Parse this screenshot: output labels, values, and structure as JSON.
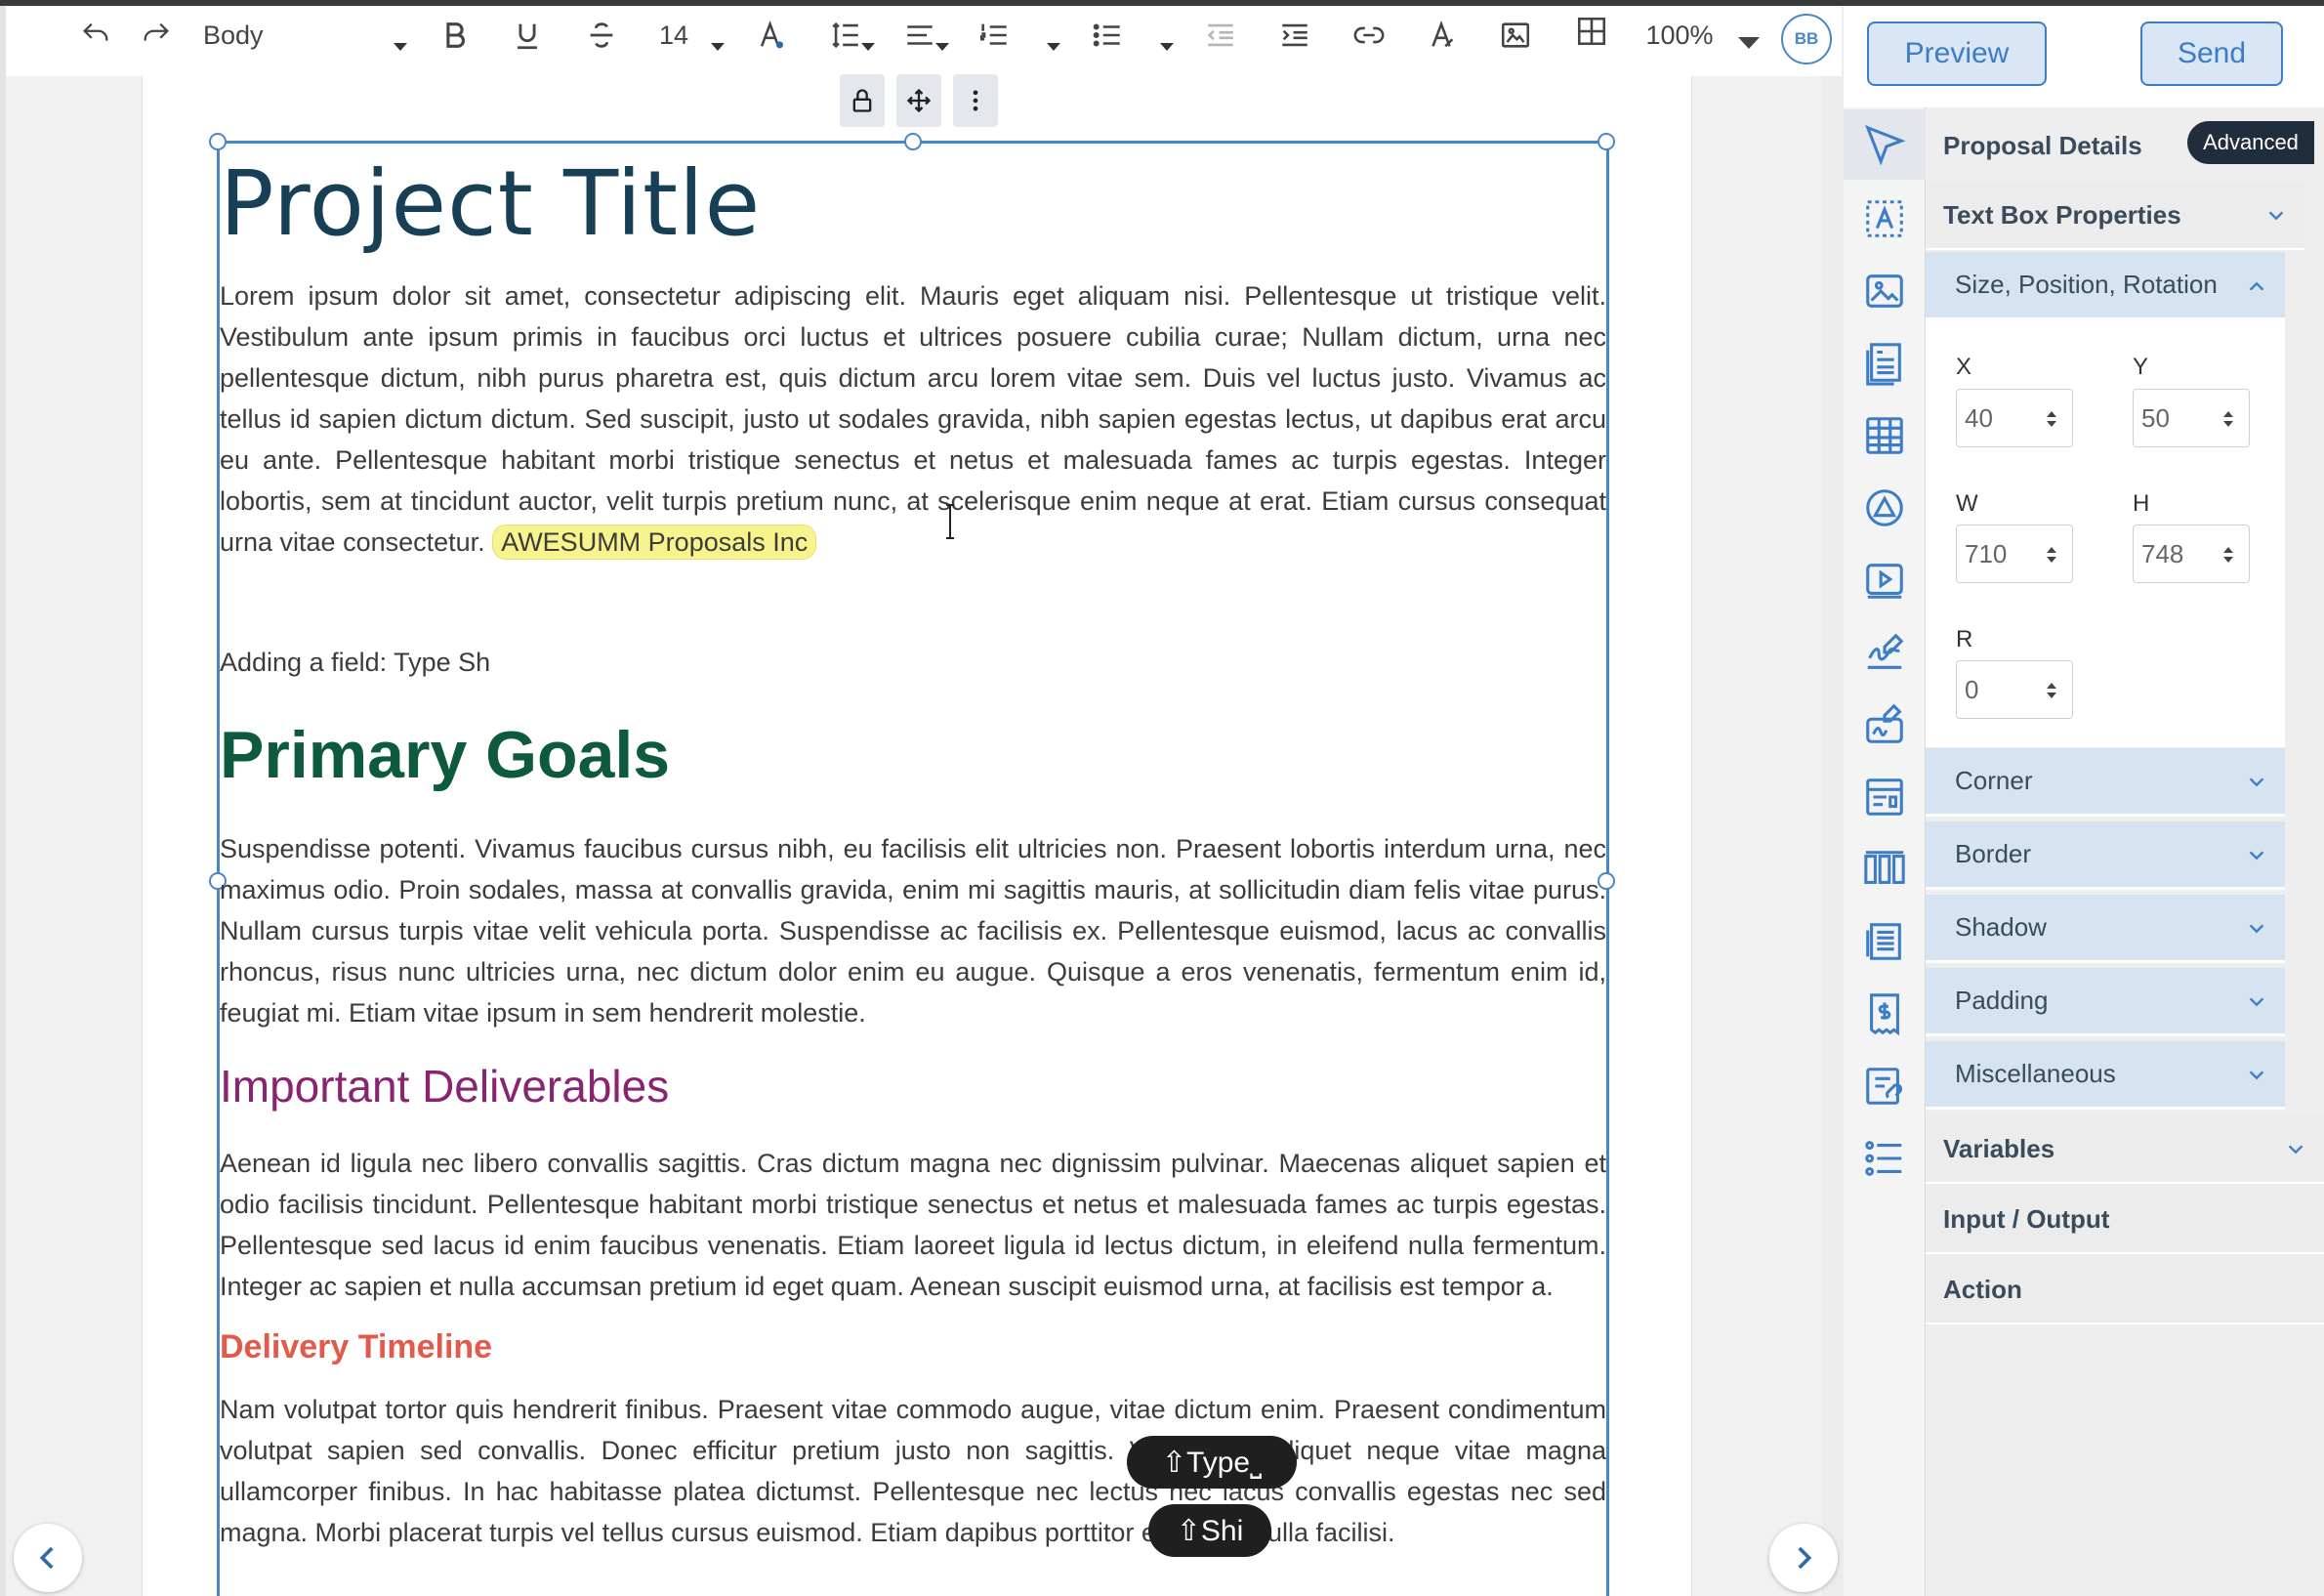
{
  "toolbar": {
    "style_select": "Body",
    "font_size": "14",
    "zoom": "100%",
    "avatar_initials": "BB"
  },
  "header": {
    "preview_label": "Preview",
    "send_label": "Send"
  },
  "document": {
    "title": "Project Title",
    "intro": "Lorem ipsum dolor sit amet, consectetur adipiscing elit. Mauris eget aliquam nisi. Pellentesque ut tristique velit. Vestibulum ante ipsum primis in faucibus orci luctus et ultrices posuere cubilia curae; Nullam dictum, urna nec pellentesque dictum, nibh purus pharetra est, quis dictum arcu lorem vitae sem. Duis vel luctus justo. Vivamus ac tellus id sapien dictum dictum. Sed suscipit, justo ut sodales gravida, nibh sapien egestas lectus, ut dapibus erat arcu eu ante. Pellentesque habitant morbi tristique senectus et netus et malesuada fames ac turpis egestas. Integer lobortis, sem at tincidunt auctor, velit turpis pretium nunc, at scelerisque enim neque at erat. Etiam cursus consequat urna vitae consectetur.",
    "company_field": "AWESUMM Proposals Inc",
    "adding_field_line": "Adding a field: Type Sh",
    "primary_goals_heading": "Primary Goals",
    "primary_goals_text": "Suspendisse potenti. Vivamus faucibus cursus nibh, eu facilisis elit ultricies non. Praesent lobortis interdum urna, nec maximus odio. Proin sodales, massa at convallis gravida, enim mi sagittis mauris, at sollicitudin diam felis vitae purus. Nullam cursus turpis vitae velit vehicula porta. Suspendisse ac facilisis ex. Pellentesque euismod, lacus ac convallis rhoncus, risus nunc ultricies urna, nec dictum dolor enim eu augue. Quisque a eros venenatis, fermentum enim id, feugiat mi. Etiam vitae ipsum in sem hendrerit molestie.",
    "deliverables_heading": "Important Deliverables",
    "deliverables_text": "Aenean id ligula nec libero convallis sagittis. Cras dictum magna nec dignissim pulvinar. Maecenas aliquet sapien et odio facilisis tincidunt. Pellentesque habitant morbi tristique senectus et netus et malesuada fames ac turpis egestas. Pellentesque sed lacus id enim faucibus venenatis. Etiam laoreet ligula id lectus dictum, in eleifend nulla fermentum. Integer ac sapien et nulla accumsan pretium id eget quam. Aenean suscipit euismod urna, at facilisis est tempor a.",
    "timeline_heading": "Delivery Timeline",
    "timeline_text": "Nam volutpat tortor quis hendrerit finibus. Praesent vitae commodo augue, vitae dictum enim. Praesent condimentum volutpat sapien sed convallis. Donec efficitur pretium justo non sagittis. Vestibulum aliquet neque vitae magna ullamcorper finibus. In hac habitasse platea dictumst. Pellentesque nec lectus nec lacus convallis egestas nec sed magna. Morbi placerat turpis vel tellus cursus euismod. Etiam dapibus porttitor egestas. Nulla facilisi."
  },
  "keystroke_chips": {
    "chip1": "⇧Type⎵",
    "chip2": "⇧Shi"
  },
  "panel": {
    "proposal_details": "Proposal Details",
    "advanced_label": "Advanced",
    "text_box_properties": "Text Box Properties",
    "size_position_rotation": "Size, Position, Rotation",
    "x_label": "X",
    "x_value": "40",
    "y_label": "Y",
    "y_value": "50",
    "w_label": "W",
    "w_value": "710",
    "h_label": "H",
    "h_value": "748",
    "r_label": "R",
    "r_value": "0",
    "corner": "Corner",
    "border": "Border",
    "shadow": "Shadow",
    "padding": "Padding",
    "miscellaneous": "Miscellaneous",
    "variables": "Variables",
    "input_output": "Input / Output",
    "action": "Action"
  },
  "colors": {
    "accent": "#4a86c6",
    "title": "#173f56",
    "primary_goals": "#0e5a3c",
    "deliverables": "#8a2471",
    "timeline": "#e25b4a"
  },
  "icons": {
    "toolbar": [
      "undo-icon",
      "redo-icon",
      "bold-icon",
      "underline-icon",
      "strikethrough-icon",
      "text-color-icon",
      "line-spacing-icon",
      "align-icon",
      "numbered-list-icon",
      "bullet-list-icon",
      "outdent-icon",
      "indent-icon",
      "link-icon",
      "clear-format-icon",
      "image-icon",
      "table-icon"
    ],
    "sidebar": [
      "select-tool-icon",
      "text-box-icon",
      "image-block-icon",
      "pricing-table-icon",
      "table-block-icon",
      "shape-icon",
      "video-icon",
      "signature-icon",
      "initials-icon",
      "form-icon",
      "columns-icon",
      "toc-icon",
      "invoice-icon",
      "attachment-icon",
      "list-block-icon"
    ]
  }
}
